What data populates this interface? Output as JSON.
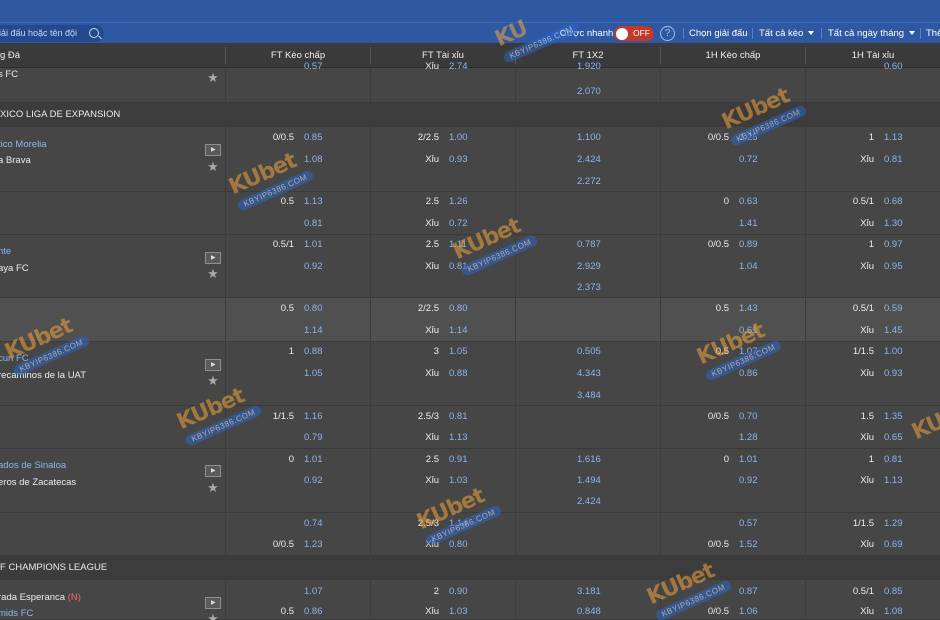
{
  "toolbar": {
    "search_placeholder": "iải đấu hoặc tên đội",
    "quick_bet_label": "Cược nhanh",
    "quick_bet_state": "OFF",
    "help_label": "?",
    "choose_league": "Chọn giải đấu",
    "all_bet_types": "Tất cả kèo",
    "all_dates": "Tất cả ngày tháng",
    "more": "Thể"
  },
  "columns": {
    "match": "g Đá",
    "ft_handicap": "FT Kèo chấp",
    "ft_over_under": "FT Tài xỉu",
    "ft_1x2": "FT 1X2",
    "h1_handicap": "1H Kèo chấp",
    "h1_over_under": "1H Tài xỉu"
  },
  "leagues": [
    {
      "name": "XICO LIGA DE EXPANSION"
    },
    {
      "name": "F CHAMPIONS LEAGUE"
    }
  ],
  "rows": {
    "r0": {
      "team": "s FC",
      "ft_1x2_c": "2.070",
      "partial_ft_hdp_odd": "0.57",
      "partial_ou_label": "Xỉu",
      "partial_ou_odd": "2.74",
      "partial_1x2": "1.920",
      "partial_h1_ou": "0.60"
    },
    "r1": {
      "home": "tico Morelia",
      "away": "a Brava",
      "ft_hdp_line": "0/0.5",
      "ft_hdp_home": "0.85",
      "ft_hdp_away": "1.08",
      "ft_ou_line": "2/2.5",
      "ft_ou_over": "1.00",
      "ft_ou_under_label": "Xỉu",
      "ft_ou_under": "0.93",
      "x1": "1.100",
      "x2": "2.424",
      "x3": "2.272",
      "h1_hdp_line": "0/0.5",
      "h1_hdp_home": "1.25",
      "h1_hdp_away": "0.72",
      "h1_ou_line": "1",
      "h1_ou_over": "1.13",
      "h1_ou_under_label": "Xỉu",
      "h1_ou_under": "0.81"
    },
    "r2": {
      "ft_hdp_line": "0.5",
      "ft_hdp_home": "1.13",
      "ft_hdp_away": "0.81",
      "ft_ou_line": "2.5",
      "ft_ou_over": "1.26",
      "ft_ou_under_label": "Xỉu",
      "ft_ou_under": "0.72",
      "h1_hdp_line": "0",
      "h1_hdp_home": "0.63",
      "h1_hdp_away": "1.41",
      "h1_ou_line": "0.5/1",
      "h1_ou_over": "0.68",
      "h1_ou_under_label": "Xỉu",
      "h1_ou_under": "1.30"
    },
    "r3": {
      "home": "nte",
      "away": "aya FC",
      "ft_hdp_line": "0.5/1",
      "ft_hdp_home": "1.01",
      "ft_hdp_away": "0.92",
      "ft_ou_line": "2.5",
      "ft_ou_over": "1.11",
      "ft_ou_under_label": "Xỉu",
      "ft_ou_under": "0.81",
      "x1": "0.787",
      "x2": "2.929",
      "x3": "2.373",
      "h1_hdp_line": "0/0.5",
      "h1_hdp_home": "0.89",
      "h1_hdp_away": "1.04",
      "h1_ou_line": "1",
      "h1_ou_over": "0.97",
      "h1_ou_under_label": "Xỉu",
      "h1_ou_under": "0.95"
    },
    "r4": {
      "ft_hdp_line": "0.5",
      "ft_hdp_home": "0.80",
      "ft_hdp_away": "1.14",
      "ft_ou_line": "2/2.5",
      "ft_ou_over": "0.80",
      "ft_ou_under_label": "Xỉu",
      "ft_ou_under": "1.14",
      "h1_hdp_line": "0.5",
      "h1_hdp_home": "1.43",
      "h1_hdp_away": "0.61",
      "h1_ou_line": "0.5/1",
      "h1_ou_over": "0.59",
      "h1_ou_under_label": "Xỉu",
      "h1_ou_under": "1.45"
    },
    "r5": {
      "home": "cun FC",
      "away": "recaminos de la UAT",
      "ft_hdp_line": "1",
      "ft_hdp_home": "0.88",
      "ft_hdp_away": "1.05",
      "ft_ou_line": "3",
      "ft_ou_over": "1.05",
      "ft_ou_under_label": "Xỉu",
      "ft_ou_under": "0.88",
      "x1": "0.505",
      "x2": "4.343",
      "x3": "3.484",
      "h1_hdp_line": "0.5",
      "h1_hdp_home": "1.07",
      "h1_hdp_away": "0.86",
      "h1_ou_line": "1/1.5",
      "h1_ou_over": "1.00",
      "h1_ou_under_label": "Xỉu",
      "h1_ou_under": "0.93"
    },
    "r6": {
      "ft_hdp_line": "1/1.5",
      "ft_hdp_home": "1.16",
      "ft_hdp_away": "0.79",
      "ft_ou_line": "2.5/3",
      "ft_ou_over": "0.81",
      "ft_ou_under_label": "Xỉu",
      "ft_ou_under": "1.13",
      "h1_hdp_line": "0/0.5",
      "h1_hdp_home": "0.70",
      "h1_hdp_away": "1.28",
      "h1_ou_line": "1.5",
      "h1_ou_over": "1.35",
      "h1_ou_under_label": "Xỉu",
      "h1_ou_under": "0.65"
    },
    "r7": {
      "home": "ados de Sinaloa",
      "away": "eros de Zacatecas",
      "ft_hdp_line": "0",
      "ft_hdp_home": "1.01",
      "ft_hdp_away": "0.92",
      "ft_ou_line": "2.5",
      "ft_ou_over": "0.91",
      "ft_ou_under_label": "Xỉu",
      "ft_ou_under": "1.03",
      "x1": "1.616",
      "x2": "1.494",
      "x3": "2.424",
      "h1_hdp_line": "0",
      "h1_hdp_home": "1.01",
      "h1_hdp_away": "0.92",
      "h1_ou_line": "1",
      "h1_ou_over": "0.81",
      "h1_ou_under_label": "Xỉu",
      "h1_ou_under": "1.13"
    },
    "r8": {
      "ft_hdp_line_away": "0/0.5",
      "ft_hdp_home": "0.74",
      "ft_hdp_away": "1.23",
      "ft_ou_line": "2.5/3",
      "ft_ou_over": "1.14",
      "ft_ou_under_label": "Xỉu",
      "ft_ou_under": "0.80",
      "h1_hdp_line_away": "0/0.5",
      "h1_hdp_home": "0.57",
      "h1_hdp_away": "1.52",
      "h1_ou_line": "1/1.5",
      "h1_ou_over": "1.29",
      "h1_ou_under_label": "Xỉu",
      "h1_ou_under": "0.69"
    },
    "r9": {
      "home": "rada Esperanca",
      "neutral": "(N)",
      "away": "mids FC",
      "ft_hdp_line_away": "0.5",
      "ft_hdp_home": "1.07",
      "ft_hdp_away": "0.86",
      "ft_ou_line": "2",
      "ft_ou_over": "0.90",
      "ft_ou_under_label": "Xỉu",
      "ft_ou_under": "1.03",
      "x1": "3.181",
      "x2": "0.848",
      "h1_hdp_line_away": "0/0.5",
      "h1_hdp_home": "0.87",
      "h1_hdp_away": "1.06",
      "h1_ou_line": "0.5/1",
      "h1_ou_over": "0.85",
      "h1_ou_under_label": "Xỉu",
      "h1_ou_under": "1.08"
    }
  },
  "icons": {
    "star": "star-icon",
    "live": "live-stream-icon",
    "search": "search-icon",
    "help": "help-icon",
    "caret": "chevron-down-icon"
  },
  "watermark": {
    "brand": "KU",
    "brand_suffix": "bet",
    "url": "KBYIP6386.COM"
  },
  "colors": {
    "header_blue": "#2f58a3",
    "odds_blue": "#8cb6ec",
    "toggle_red": "#c0392b",
    "body_bg": "#464646"
  }
}
